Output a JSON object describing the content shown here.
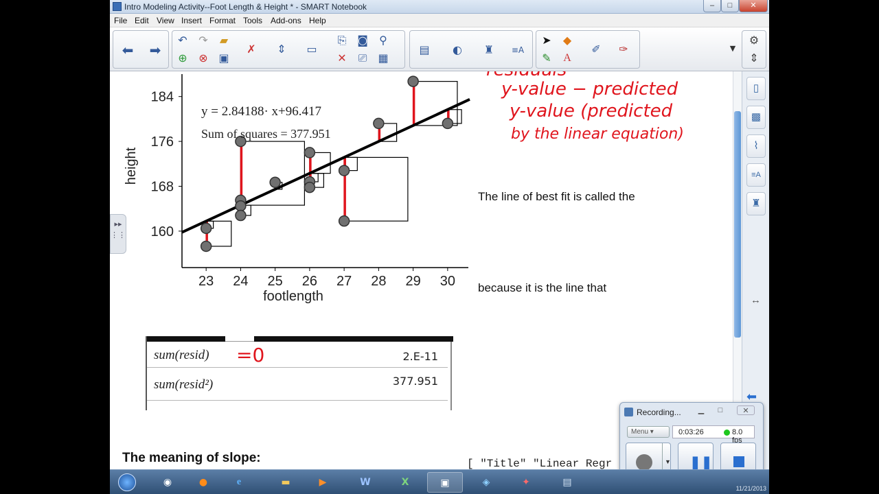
{
  "window": {
    "title": "Intro Modeling Activity--Foot Length & Height * - SMART Notebook",
    "minimize": "–",
    "maximize": "□",
    "close": "✕"
  },
  "menu": [
    "File",
    "Edit",
    "View",
    "Insert",
    "Format",
    "Tools",
    "Add-ons",
    "Help"
  ],
  "chart_data": {
    "type": "scatter",
    "xlabel": "footlength",
    "ylabel": "height",
    "xlim": [
      22.3,
      30.6
    ],
    "ylim": [
      153.5,
      188
    ],
    "x_ticks": [
      23,
      24,
      25,
      26,
      27,
      28,
      29,
      30
    ],
    "y_ticks": [
      160,
      168,
      176,
      184
    ],
    "points": [
      {
        "x": 23,
        "y": 160.5
      },
      {
        "x": 23,
        "y": 157.3
      },
      {
        "x": 24,
        "y": 176
      },
      {
        "x": 24,
        "y": 165.5
      },
      {
        "x": 24,
        "y": 164.5
      },
      {
        "x": 24,
        "y": 162.8
      },
      {
        "x": 25,
        "y": 168.7
      },
      {
        "x": 26,
        "y": 174
      },
      {
        "x": 26,
        "y": 168.8
      },
      {
        "x": 26,
        "y": 167.8
      },
      {
        "x": 27,
        "y": 170.8
      },
      {
        "x": 27,
        "y": 161.8
      },
      {
        "x": 28,
        "y": 179.2
      },
      {
        "x": 29,
        "y": 186.7
      },
      {
        "x": 30,
        "y": 179.2
      }
    ],
    "regression": {
      "slope": 2.84188,
      "intercept": 96.417
    },
    "equation_text": "y = 2.84188· x+96.417",
    "sum_of_squares_text": "Sum of squares = 377.951",
    "tick_label_y_top": "184"
  },
  "annotations": {
    "handwriting_lines": [
      "residuals",
      "y-value − predicted",
      "y-value (predicted",
      "by the linear equation)"
    ],
    "equals_zero": "=0"
  },
  "text": {
    "best_fit": "The line of best fit is called the",
    "because": "because it is the line that",
    "slope_heading": "The meaning of slope:",
    "cut_text": "[  \"Title\"     \"Linear Regr"
  },
  "calc": {
    "rows": [
      {
        "expr": "sum(resid)",
        "value": "2.E-11"
      },
      {
        "expr": "sum(resid²)",
        "value": "377.951"
      }
    ]
  },
  "recorder": {
    "title": "Recording...",
    "menu_label": "Menu",
    "elapsed": "0:03:26",
    "fps": "8.0 fps"
  },
  "taskbar": {
    "clock": "11/21/2013"
  },
  "colors": {
    "ink": "#e0151d",
    "regression": "#000000",
    "points": "#707070"
  }
}
